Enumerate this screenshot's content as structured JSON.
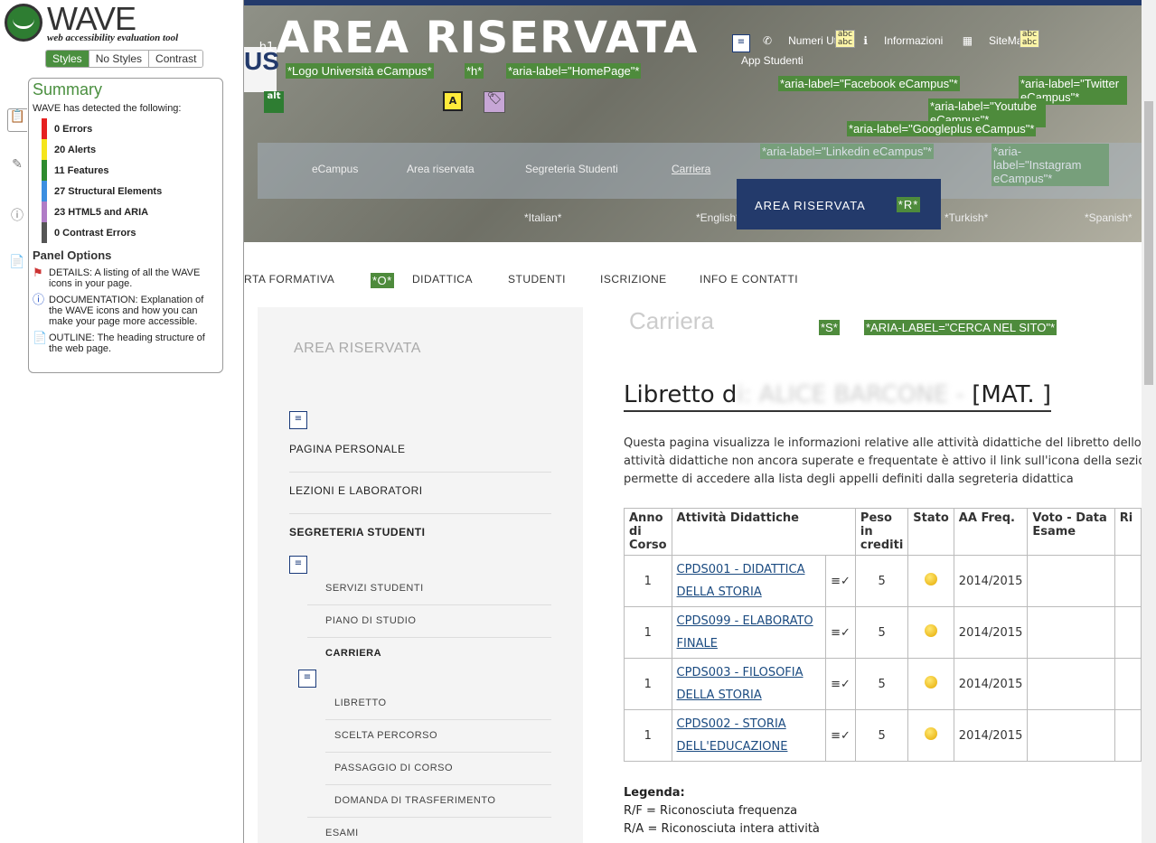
{
  "wave": {
    "title": "WAVE",
    "subtitle": "web accessibility evaluation tool",
    "tabs": [
      "Styles",
      "No Styles",
      "Contrast"
    ],
    "summary_title": "Summary",
    "detected": "WAVE has detected the following:",
    "counts": [
      {
        "label": "0 Errors",
        "color": "#e62020"
      },
      {
        "label": "20 Alerts",
        "color": "#f5e51b"
      },
      {
        "label": "11 Features",
        "color": "#2e8b2e"
      },
      {
        "label": "27 Structural Elements",
        "color": "#3b8ee0"
      },
      {
        "label": "23 HTML5 and ARIA",
        "color": "#b07cc6"
      },
      {
        "label": "0 Contrast Errors",
        "color": "#555555"
      }
    ],
    "panel_options_title": "Panel Options",
    "options": [
      "DETAILS: A listing of all the WAVE icons in your page.",
      "DOCUMENTATION: Explanation of the WAVE icons and how you can make your page more accessible.",
      "OUTLINE: The heading structure of the web page."
    ]
  },
  "header": {
    "hero_title": "AREA RISERVATA",
    "logo_text": "US",
    "tag_logo": "*Logo Università eCampus*",
    "tag_h": "*h*",
    "tag_home": "*aria-label=\"HomePage\"*",
    "top_links": [
      "Numeri Utili",
      "Informazioni",
      "SiteMap"
    ],
    "app_link": "App Studenti",
    "social_tags": [
      "*aria-label=\"Facebook eCampus\"*",
      "*aria-label=\"Twitter eCampus\"*",
      "*aria-label=\"Youtube eCampus\"*",
      "*aria-label=\"Googleplus eCampus\"*",
      "*aria-label=\"Linkedin eCampus\"*",
      "*aria-label=\"Instagram eCampus\"*"
    ],
    "area_button": "AREA RISERVATA",
    "area_tag": "*R*",
    "breadcrumbs": [
      "eCampus",
      "Area riservata",
      "Segreteria Studenti",
      "Carriera"
    ],
    "languages": [
      "*Italian*",
      "*English*",
      "*Turkish*",
      "*Spanish*"
    ]
  },
  "nav": {
    "items": [
      "RTA FORMATIVA",
      "DIDATTICA",
      "STUDENTI",
      "ISCRIZIONE",
      "INFO E CONTATTI"
    ],
    "tag_o": "*O*",
    "tag_s": "*S*",
    "search_tag": "*ARIA-LABEL=\"CERCA NEL SITO\"*"
  },
  "sidebar": {
    "heading": "AREA RISERVATA",
    "items": [
      "PAGINA PERSONALE",
      "LEZIONI E LABORATORI",
      "SEGRETERIA STUDENTI"
    ],
    "sub_items": [
      "SERVIZI STUDENTI",
      "PIANO DI STUDIO",
      "CARRIERA"
    ],
    "sub_sub_items": [
      "LIBRETTO",
      "SCELTA PERCORSO",
      "PASSAGGIO DI CORSO",
      "DOMANDA DI TRASFERIMENTO"
    ],
    "last_item": "ESAMI"
  },
  "main": {
    "page_heading": "Carriera",
    "libretto_prefix": "Libretto d",
    "libretto_blur": "i: ALICE BARCONE -",
    "libretto_suffix": "[MAT. ]",
    "description": "Questa pagina visualizza le informazioni relative alle attività didattiche del libretto dello s attività didattiche non ancora superate e frequentate è attivo il link sull'icona della sezion permette di accedere alla lista degli appelli definiti dalla segreteria didattica",
    "table": {
      "headers": [
        "Anno di Corso",
        "Attività Didattiche",
        "Peso in crediti",
        "Stato",
        "AA Freq.",
        "Voto - Data Esame",
        "Ri"
      ],
      "rows": [
        {
          "anno": "1",
          "attivita": "CPDS001 - DIDATTICA DELLA STORIA",
          "peso": "5",
          "aa": "2014/2015"
        },
        {
          "anno": "1",
          "attivita": "CPDS099 - ELABORATO FINALE",
          "peso": "5",
          "aa": "2014/2015"
        },
        {
          "anno": "1",
          "attivita": "CPDS003 - FILOSOFIA DELLA STORIA",
          "peso": "5",
          "aa": "2014/2015"
        },
        {
          "anno": "1",
          "attivita": "CPDS002 - STORIA DELL'EDUCAZIONE",
          "peso": "5",
          "aa": "2014/2015"
        }
      ]
    },
    "legend_title": "Legenda:",
    "legend_items": [
      "R/F = Riconosciuta frequenza",
      "R/A = Riconosciuta intera attività"
    ]
  }
}
